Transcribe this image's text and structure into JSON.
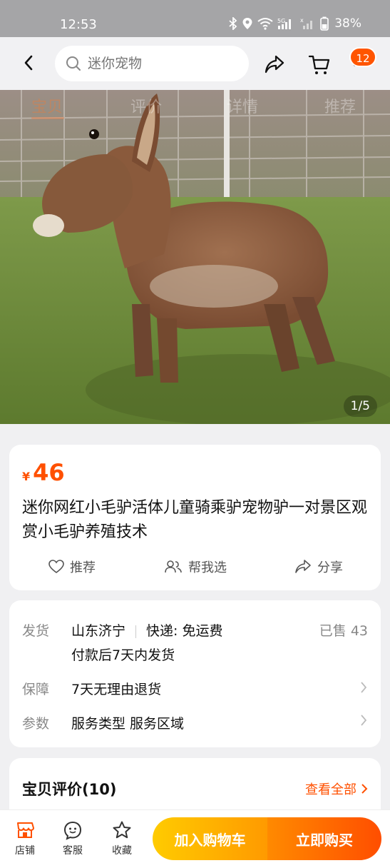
{
  "status_bar": {
    "time": "12:53",
    "battery": "38%",
    "icons": [
      "bluetooth-icon",
      "location-icon",
      "wifi-icon",
      "5g-signal-icon",
      "signal-icon",
      "battery-icon"
    ]
  },
  "header": {
    "search_placeholder": "迷你宠物",
    "cart_badge": "12"
  },
  "hero": {
    "tabs": [
      "宝贝",
      "评价",
      "详情",
      "推荐"
    ],
    "page_indicator": "1/5"
  },
  "product": {
    "currency": "¥",
    "price": "46",
    "title": "迷你网红小毛驴活体儿童骑乘驴宠物驴一对景区观赏小毛驴养殖技术",
    "actions": {
      "recommend": "推荐",
      "help_choose": "帮我选",
      "share": "分享"
    }
  },
  "info": {
    "shipping_label": "发货",
    "origin": "山东济宁",
    "delivery": "快递: 免运费",
    "sold": "已售 43",
    "ship_time": "付款后7天内发货",
    "guarantee_label": "保障",
    "guarantee": "7天无理由退货",
    "params_label": "参数",
    "params": "服务类型 服务区域"
  },
  "reviews": {
    "title": "宝贝评价(10)",
    "view_all": "查看全部"
  },
  "bottom_bar": {
    "shop": "店铺",
    "service": "客服",
    "favorite": "收藏",
    "add_to_cart": "加入购物车",
    "buy_now": "立即购买"
  },
  "colors": {
    "accent": "#ff5000",
    "cart_gradient": [
      "#ffcb00",
      "#ff9a00"
    ],
    "buy_gradient": [
      "#ff8a00",
      "#ff4e00"
    ]
  }
}
